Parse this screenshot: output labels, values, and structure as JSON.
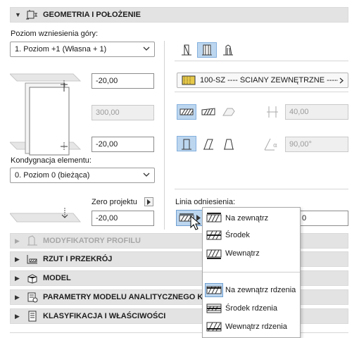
{
  "sections": {
    "geometry": {
      "title": "GEOMETRIA I POŁOŻENIE",
      "expanded": true
    },
    "profile_modifiers": {
      "title": "MODYFIKATORY PROFILU",
      "disabled": true
    },
    "plan_section": {
      "title": "RZUT I PRZEKRÓJ"
    },
    "model": {
      "title": "MODEL"
    },
    "analytical": {
      "title": "PARAMETRY MODELU ANALITYCZNEGO KO"
    },
    "classification": {
      "title": "KLASYFIKACJA I WŁAŚCIWOŚCI"
    }
  },
  "geometry": {
    "top_level_label": "Poziom wzniesienia góry:",
    "top_level_value": "1. Poziom +1 (Własna + 1)",
    "top_offset": "-20,00",
    "height": "300,00",
    "bottom_offset": "-20,00",
    "home_story_label": "Kondygnacja elementu:",
    "home_story_value": "0. Poziom 0 (bieżąca)",
    "zero_label": "Zero projektu",
    "zero_value": "-20,00",
    "composite": "100-SZ ---- ŚCIANY ZEWNĘTRZNE ------",
    "thickness": "40,00",
    "slant_angle": "90,00°",
    "ref_line_label": "Linia odniesienia:",
    "ref_line_value": "0"
  },
  "popup": {
    "items": [
      {
        "label": "Na zewnątrz",
        "group": 1
      },
      {
        "label": "Środek",
        "group": 1
      },
      {
        "label": "Wewnątrz",
        "group": 1
      },
      {
        "label": "Na zewnątrz rdzenia",
        "group": 2,
        "selected": true
      },
      {
        "label": "Środek rdzenia",
        "group": 2
      },
      {
        "label": "Wewnątrz rdzenia",
        "group": 2
      }
    ]
  },
  "colors": {
    "selected_bg": "#bcd6ef",
    "header_bg": "#e3e3e3"
  }
}
